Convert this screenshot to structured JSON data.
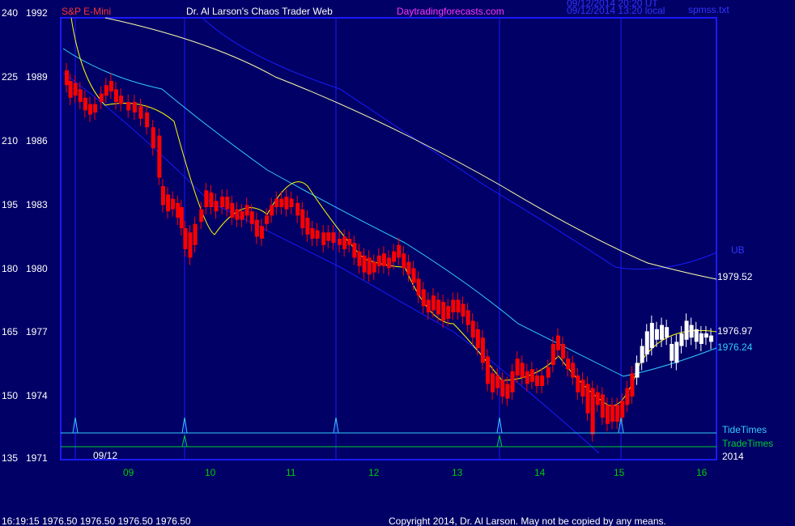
{
  "header": {
    "instrument": "S&P E-Mini",
    "author": "Dr. Al Larson's Chaos Trader Web",
    "website": "Daytradingforecasts.com",
    "timestamp_ut": "09/12/2014 20:20 UT",
    "timestamp_local": "09/12/2014 13:20 local",
    "file": "spmss.txt"
  },
  "footer": {
    "quote": "16:19:15  1976.50 1976.50 1976.50 1976.50",
    "copyright": "Copyright 2014, Dr. Al Larson. May not be copied by any means."
  },
  "colors": {
    "background": "#000066",
    "frame": "#1a1aff",
    "bull_candle": "#ffffff",
    "bear_candle": "#ff0000",
    "upper_band": "#1a1aff",
    "slow_ma": "#ffffaa",
    "mid_ma": "#33ccff",
    "fast_ma": "#ffff00",
    "tide_times": "#33ccff",
    "trade_times": "#00cc33",
    "day_lines": "#1a1aff",
    "axis_text": "#ffffff",
    "day_text": "#00cc00",
    "title_red": "#ff3333",
    "title_white": "#ffffff",
    "title_magenta": "#ff33ff"
  },
  "chart_data": {
    "type": "candlestick",
    "y_left_labels": [
      "240",
      "225",
      "210",
      "195",
      "180",
      "165",
      "150",
      "135"
    ],
    "y_right_labels": [
      "1992",
      "1989",
      "1986",
      "1983",
      "1980",
      "1977",
      "1974",
      "1971"
    ],
    "ylim": [
      1971,
      1992
    ],
    "x_day_labels": [
      "09",
      "10",
      "11",
      "12",
      "13",
      "14",
      "15",
      "16"
    ],
    "date_label": "09/12",
    "year_label": "2014",
    "series_labels": {
      "upper_band": "UB",
      "slow_ma_value": "1979.52",
      "fast_ma_value": "1976.97",
      "mid_ma_value": "1976.24",
      "tide_times": "TideTimes",
      "trade_times": "TradeTimes"
    },
    "candles_red": [
      [
        0.0,
        1989.5,
        1988.8
      ],
      [
        0.15,
        1989.0,
        1988.2
      ],
      [
        0.35,
        1988.9,
        1988.3
      ],
      [
        0.55,
        1988.6,
        1988.0
      ],
      [
        0.75,
        1988.2,
        1987.6
      ],
      [
        0.95,
        1987.9,
        1987.4
      ],
      [
        1.15,
        1987.9,
        1987.5
      ],
      [
        1.4,
        1988.4,
        1988.0
      ],
      [
        1.6,
        1988.8,
        1988.3
      ],
      [
        1.8,
        1989.0,
        1988.5
      ],
      [
        2.0,
        1988.6,
        1988.0
      ],
      [
        2.2,
        1988.3,
        1987.9
      ],
      [
        2.5,
        1988.0,
        1987.6
      ],
      [
        2.75,
        1988.0,
        1987.5
      ],
      [
        3.0,
        1987.8,
        1987.2
      ],
      [
        3.25,
        1987.5,
        1986.8
      ],
      [
        3.5,
        1986.8,
        1985.8
      ],
      [
        3.75,
        1986.4,
        1984.4
      ],
      [
        3.9,
        1984.0,
        1983.1
      ],
      [
        4.1,
        1983.6,
        1982.8
      ],
      [
        4.3,
        1983.4,
        1982.9
      ],
      [
        4.5,
        1983.2,
        1982.5
      ],
      [
        4.65,
        1983.0,
        1982.0
      ],
      [
        4.8,
        1982.0,
        1981.0
      ],
      [
        5.0,
        1981.8,
        1980.6
      ],
      [
        5.2,
        1982.2,
        1981.2
      ],
      [
        5.45,
        1982.9,
        1982.3
      ],
      [
        5.65,
        1983.8,
        1983.0
      ],
      [
        5.85,
        1983.7,
        1983.0
      ],
      [
        6.05,
        1983.3,
        1982.8
      ],
      [
        6.3,
        1983.5,
        1983.0
      ],
      [
        6.5,
        1983.5,
        1982.9
      ],
      [
        6.7,
        1983.2,
        1982.5
      ],
      [
        6.9,
        1982.9,
        1982.4
      ],
      [
        7.1,
        1982.8,
        1982.4
      ],
      [
        7.3,
        1983.1,
        1982.6
      ],
      [
        7.5,
        1982.8,
        1982.2
      ],
      [
        7.7,
        1982.4,
        1981.6
      ],
      [
        7.9,
        1982.1,
        1981.5
      ],
      [
        8.1,
        1982.6,
        1982.2
      ],
      [
        8.3,
        1983.1,
        1982.6
      ],
      [
        8.5,
        1983.4,
        1983.0
      ],
      [
        8.7,
        1983.4,
        1983.0
      ],
      [
        8.9,
        1983.5,
        1982.9
      ],
      [
        9.1,
        1983.4,
        1983.0
      ],
      [
        9.35,
        1983.2,
        1982.6
      ],
      [
        9.55,
        1982.9,
        1982.0
      ],
      [
        9.75,
        1982.5,
        1981.7
      ],
      [
        9.95,
        1982.0,
        1981.5
      ],
      [
        10.15,
        1981.9,
        1981.5
      ],
      [
        10.4,
        1981.8,
        1981.2
      ],
      [
        10.6,
        1981.8,
        1981.4
      ],
      [
        10.8,
        1981.8,
        1981.3
      ],
      [
        11.05,
        1981.5,
        1981.2
      ],
      [
        11.25,
        1981.6,
        1981.0
      ],
      [
        11.45,
        1981.5,
        1981.2
      ],
      [
        11.65,
        1981.3,
        1980.6
      ],
      [
        11.85,
        1980.9,
        1980.2
      ],
      [
        12.05,
        1980.7,
        1979.9
      ],
      [
        12.25,
        1980.6,
        1979.8
      ],
      [
        12.45,
        1980.4,
        1979.9
      ],
      [
        12.65,
        1980.7,
        1980.2
      ],
      [
        12.85,
        1980.8,
        1980.2
      ],
      [
        13.05,
        1980.6,
        1980.1
      ],
      [
        13.25,
        1980.9,
        1980.4
      ],
      [
        13.45,
        1981.2,
        1980.6
      ],
      [
        13.65,
        1980.8,
        1980.1
      ],
      [
        13.85,
        1980.4,
        1979.8
      ],
      [
        14.05,
        1980.1,
        1979.4
      ],
      [
        14.25,
        1979.6,
        1978.8
      ],
      [
        14.45,
        1979.1,
        1978.3
      ],
      [
        14.65,
        1978.6,
        1978.0
      ],
      [
        14.85,
        1978.8,
        1978.1
      ],
      [
        15.05,
        1978.6,
        1977.9
      ],
      [
        15.25,
        1978.5,
        1977.6
      ],
      [
        15.45,
        1978.3,
        1977.7
      ],
      [
        15.65,
        1978.6,
        1978.0
      ],
      [
        15.85,
        1978.6,
        1978.0
      ],
      [
        16.05,
        1978.4,
        1977.8
      ],
      [
        16.25,
        1978.1,
        1977.4
      ],
      [
        16.45,
        1977.6,
        1976.8
      ],
      [
        16.65,
        1977.2,
        1976.3
      ],
      [
        16.85,
        1976.8,
        1975.6
      ],
      [
        17.05,
        1975.9,
        1974.6
      ],
      [
        17.25,
        1975.1,
        1974.2
      ],
      [
        17.45,
        1975.0,
        1974.4
      ],
      [
        17.65,
        1974.8,
        1974.0
      ],
      [
        17.85,
        1974.6,
        1973.9
      ],
      [
        18.05,
        1975.2,
        1974.2
      ],
      [
        18.25,
        1975.8,
        1975.0
      ],
      [
        18.45,
        1975.6,
        1974.9
      ],
      [
        18.65,
        1975.2,
        1974.6
      ],
      [
        18.85,
        1975.3,
        1974.7
      ],
      [
        19.05,
        1975.0,
        1974.5
      ],
      [
        19.25,
        1975.0,
        1974.5
      ],
      [
        19.5,
        1975.4,
        1974.9
      ],
      [
        19.7,
        1976.5,
        1975.5
      ],
      [
        19.9,
        1976.9,
        1976.2
      ],
      [
        20.1,
        1976.5,
        1975.8
      ],
      [
        20.3,
        1975.8,
        1975.3
      ],
      [
        20.5,
        1975.6,
        1974.9
      ],
      [
        20.7,
        1975.0,
        1974.2
      ],
      [
        20.9,
        1974.8,
        1974.0
      ],
      [
        21.1,
        1974.6,
        1973.2
      ],
      [
        21.3,
        1974.4,
        1972.2
      ],
      [
        21.5,
        1974.2,
        1973.6
      ],
      [
        21.7,
        1974.1,
        1973.0
      ],
      [
        21.9,
        1973.6,
        1972.7
      ],
      [
        22.1,
        1973.6,
        1972.8
      ],
      [
        22.3,
        1973.6,
        1972.8
      ],
      [
        22.5,
        1973.8,
        1973.0
      ],
      [
        22.7,
        1974.4,
        1973.6
      ],
      [
        22.9,
        1975.1,
        1974.0
      ]
    ],
    "candles_white": [
      [
        23.1,
        1975.6,
        1974.9
      ],
      [
        23.3,
        1976.4,
        1975.6
      ],
      [
        23.5,
        1977.1,
        1976.0
      ],
      [
        23.7,
        1977.5,
        1976.3
      ],
      [
        23.9,
        1977.2,
        1976.7
      ],
      [
        24.1,
        1977.4,
        1976.7
      ],
      [
        24.3,
        1977.3,
        1976.8
      ],
      [
        24.5,
        1976.5,
        1975.7
      ],
      [
        24.7,
        1976.6,
        1975.6
      ],
      [
        24.9,
        1977.0,
        1976.4
      ],
      [
        25.1,
        1977.6,
        1976.7
      ],
      [
        25.3,
        1977.4,
        1976.8
      ],
      [
        25.5,
        1977.2,
        1976.6
      ],
      [
        25.7,
        1977.0,
        1976.5
      ],
      [
        25.9,
        1977.0,
        1976.8
      ],
      [
        26.1,
        1976.9,
        1976.6
      ]
    ]
  }
}
